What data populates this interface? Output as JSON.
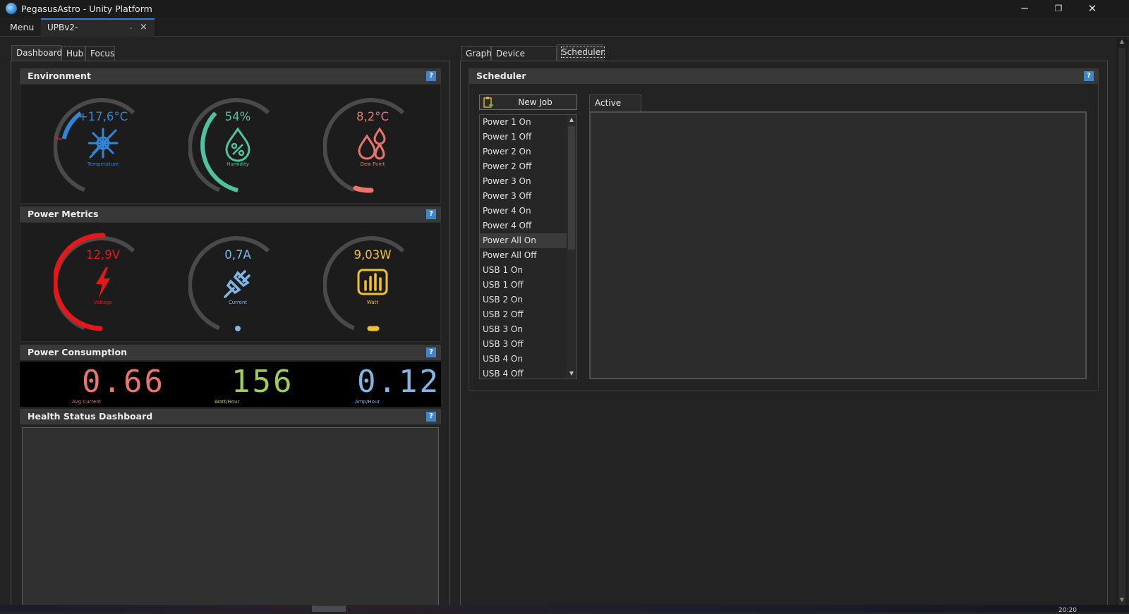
{
  "window": {
    "title": "PegasusAstro - Unity Platform",
    "controls": {
      "minimize": "─",
      "restore": "❐",
      "close": "✕"
    }
  },
  "menubar": {
    "menu_label": "Menu",
    "doc_tab": {
      "label": "UPBv2-",
      "dot": ".",
      "close": "×"
    }
  },
  "left_tabs": [
    "Dashboard",
    "Hub",
    "Focus"
  ],
  "right_tabs": [
    "Graph",
    "Device Settings",
    "Scheduler"
  ],
  "environment": {
    "title": "Environment",
    "help": "?",
    "gauges": [
      {
        "value": "+17,6°C",
        "caption": "Temperature",
        "color": "#2f86d8",
        "icon": "temperature-icon"
      },
      {
        "value": "54%",
        "caption": "Humidity",
        "color": "#4fc3a1",
        "icon": "humidity-drop-icon",
        "level": 0.54
      },
      {
        "value": "8,2°C",
        "caption": "Dew Point",
        "color": "#e8766a",
        "icon": "dew-point-drops-icon"
      }
    ]
  },
  "power_metrics": {
    "title": "Power Metrics",
    "help": "?",
    "gauges": [
      {
        "value": "12,9V",
        "caption": "Voltage",
        "color": "#e3181b",
        "icon": "lightning-icon"
      },
      {
        "value": "0,7A",
        "caption": "Current",
        "color": "#7fb6e6",
        "icon": "plug-icon"
      },
      {
        "value": "9,03W",
        "caption": "Watt",
        "color": "#f2c12e",
        "icon": "bar-chart-icon"
      }
    ]
  },
  "power_consumption": {
    "title": "Power Consumption",
    "help": "?",
    "displays": [
      {
        "value": "0.66",
        "caption": "Avg Current",
        "color": "#e8766a"
      },
      {
        "value": "156",
        "caption": "Watt/Hour",
        "color": "#9dcf55"
      },
      {
        "value": "0.12",
        "caption": "Amp/Hour",
        "color": "#7fb6e6"
      }
    ]
  },
  "health": {
    "title": "Health Status Dashboard",
    "help": "?"
  },
  "scheduler": {
    "title": "Scheduler",
    "help": "?",
    "new_job_label": "New Job",
    "jobs": [
      "Power 1 On",
      "Power 1 Off",
      "Power 2 On",
      "Power 2 Off",
      "Power 3 On",
      "Power 3 Off",
      "Power 4 On",
      "Power 4 Off",
      "Power All On",
      "Power All Off",
      "USB 1 On",
      "USB 1 Off",
      "USB 2 On",
      "USB 2 Off",
      "USB 3 On",
      "USB 3 Off",
      "USB 4 On",
      "USB 4 Off"
    ],
    "selected_job": "Power All On",
    "active_jobs_tab": "Active Jobs"
  },
  "taskbar": {
    "clock": "20:20"
  }
}
